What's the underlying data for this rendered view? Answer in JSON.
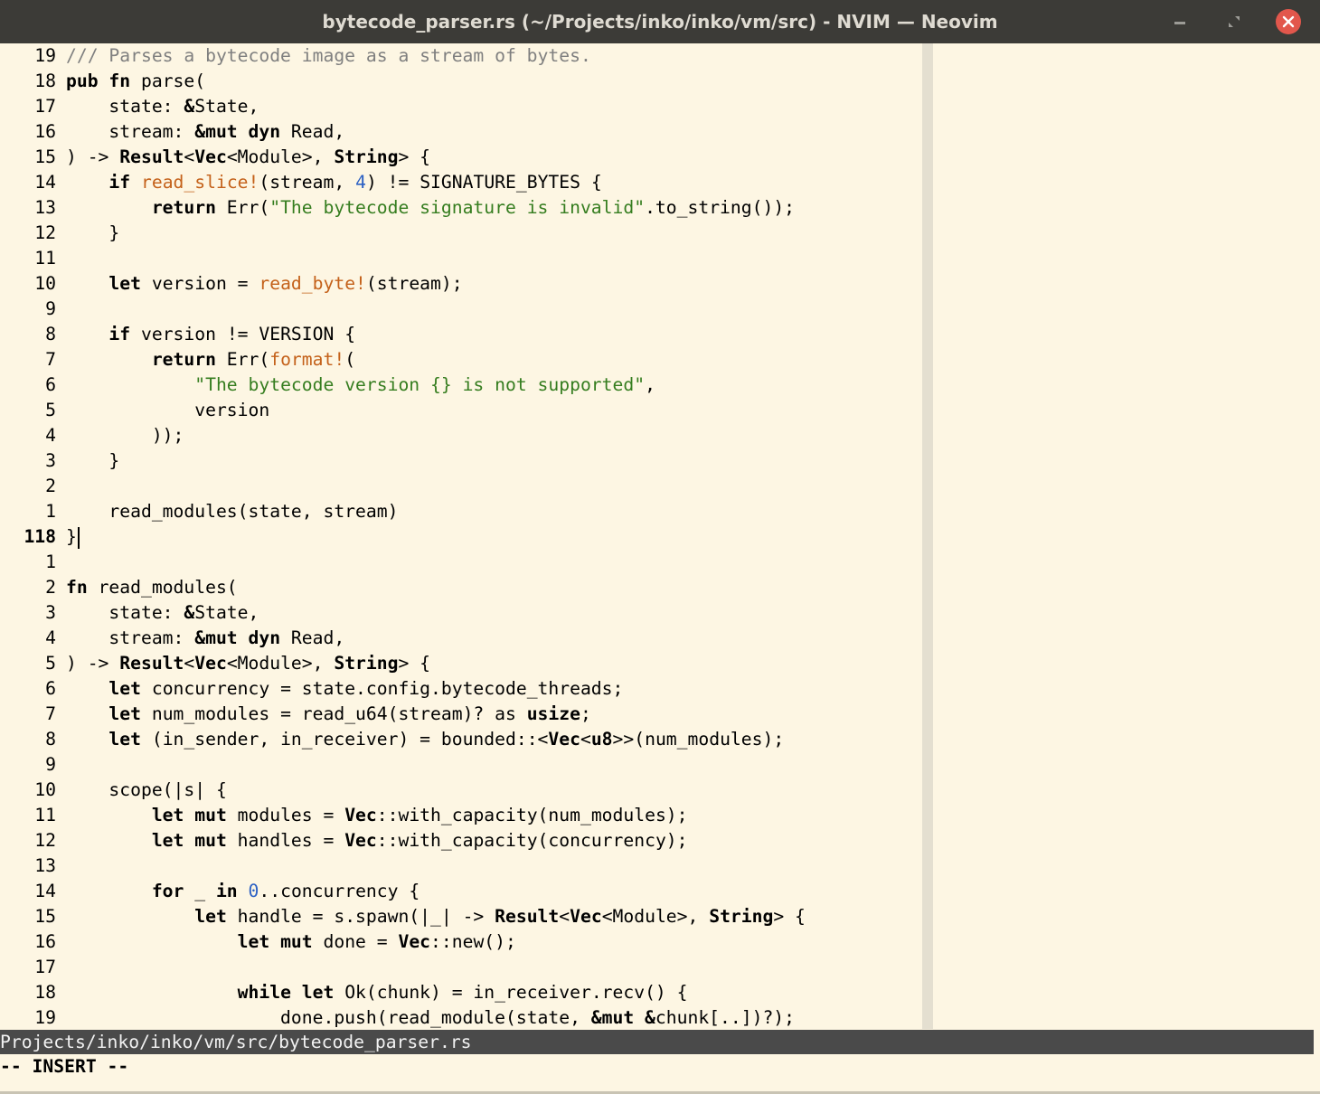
{
  "window": {
    "title": "bytecode_parser.rs (~/Projects/inko/inko/vm/src) - NVIM — Neovim",
    "buttons": {
      "minimize": "minimize",
      "maximize": "maximize",
      "close": "close"
    }
  },
  "editor": {
    "current_line": "118",
    "lines": [
      {
        "n": "19",
        "t": [
          [
            "c",
            "/// Parses a bytecode image as a stream of bytes."
          ]
        ]
      },
      {
        "n": "18",
        "t": [
          [
            "k",
            "pub fn"
          ],
          [
            "",
            "parse("
          ]
        ]
      },
      {
        "n": "17",
        "t": [
          [
            "",
            "    state: "
          ],
          [
            "k",
            "&"
          ],
          [
            "",
            "State,"
          ]
        ]
      },
      {
        "n": "16",
        "t": [
          [
            "",
            "    stream: "
          ],
          [
            "k",
            "&mut dyn"
          ],
          [
            "",
            " Read,"
          ]
        ]
      },
      {
        "n": "15",
        "t": [
          [
            "",
            ") -> "
          ],
          [
            "k",
            "Result"
          ],
          [
            "",
            "<"
          ],
          [
            "k",
            "Vec"
          ],
          [
            "",
            "<Module>, "
          ],
          [
            "k",
            "String"
          ],
          [
            "",
            "> {"
          ]
        ]
      },
      {
        "n": "14",
        "t": [
          [
            "",
            "    "
          ],
          [
            "k",
            "if"
          ],
          [
            "",
            " "
          ],
          [
            "m",
            "read_slice!"
          ],
          [
            "",
            "(stream, "
          ],
          [
            "n",
            "4"
          ],
          [
            "",
            ") != SIGNATURE_BYTES {"
          ]
        ]
      },
      {
        "n": "13",
        "t": [
          [
            "",
            "        "
          ],
          [
            "k",
            "return"
          ],
          [
            "",
            " Err("
          ],
          [
            "s",
            "\"The bytecode signature is invalid\""
          ],
          [
            "",
            ".to_string());"
          ]
        ]
      },
      {
        "n": "12",
        "t": [
          [
            "",
            "    }"
          ]
        ]
      },
      {
        "n": "11",
        "t": []
      },
      {
        "n": "10",
        "t": [
          [
            "",
            "    "
          ],
          [
            "k",
            "let"
          ],
          [
            "",
            " version = "
          ],
          [
            "m",
            "read_byte!"
          ],
          [
            "",
            "(stream);"
          ]
        ]
      },
      {
        "n": "9",
        "t": []
      },
      {
        "n": "8",
        "t": [
          [
            "",
            "    "
          ],
          [
            "k",
            "if"
          ],
          [
            "",
            " version != VERSION {"
          ]
        ]
      },
      {
        "n": "7",
        "t": [
          [
            "",
            "        "
          ],
          [
            "k",
            "return"
          ],
          [
            "",
            " Err("
          ],
          [
            "m",
            "format!"
          ],
          [
            "",
            "("
          ]
        ]
      },
      {
        "n": "6",
        "t": [
          [
            "",
            "            "
          ],
          [
            "s",
            "\"The bytecode version {} is not supported\""
          ],
          [
            "",
            ","
          ]
        ]
      },
      {
        "n": "5",
        "t": [
          [
            "",
            "            version"
          ]
        ]
      },
      {
        "n": "4",
        "t": [
          [
            "",
            "        ));"
          ]
        ]
      },
      {
        "n": "3",
        "t": [
          [
            "",
            "    }"
          ]
        ]
      },
      {
        "n": "2",
        "t": []
      },
      {
        "n": "1",
        "t": [
          [
            "",
            "    read_modules(state, stream)"
          ]
        ]
      },
      {
        "n": "118",
        "t": [
          [
            "",
            "}"
          ]
        ],
        "cursor": true
      },
      {
        "n": "1",
        "t": []
      },
      {
        "n": "2",
        "t": [
          [
            "k",
            "fn"
          ],
          [
            "",
            " read_modules("
          ]
        ]
      },
      {
        "n": "3",
        "t": [
          [
            "",
            "    state: "
          ],
          [
            "k",
            "&"
          ],
          [
            "",
            "State,"
          ]
        ]
      },
      {
        "n": "4",
        "t": [
          [
            "",
            "    stream: "
          ],
          [
            "k",
            "&mut dyn"
          ],
          [
            "",
            " Read,"
          ]
        ]
      },
      {
        "n": "5",
        "t": [
          [
            "",
            ") -> "
          ],
          [
            "k",
            "Result"
          ],
          [
            "",
            "<"
          ],
          [
            "k",
            "Vec"
          ],
          [
            "",
            "<Module>, "
          ],
          [
            "k",
            "String"
          ],
          [
            "",
            "> {"
          ]
        ]
      },
      {
        "n": "6",
        "t": [
          [
            "",
            "    "
          ],
          [
            "k",
            "let"
          ],
          [
            "",
            " concurrency = state.config.bytecode_threads;"
          ]
        ]
      },
      {
        "n": "7",
        "t": [
          [
            "",
            "    "
          ],
          [
            "k",
            "let"
          ],
          [
            "",
            " num_modules = read_u64(stream)? as "
          ],
          [
            "k",
            "usize"
          ],
          [
            "",
            ";"
          ]
        ]
      },
      {
        "n": "8",
        "t": [
          [
            "",
            "    "
          ],
          [
            "k",
            "let"
          ],
          [
            "",
            " (in_sender, in_receiver) = bounded::<"
          ],
          [
            "k",
            "Vec"
          ],
          [
            "",
            "<"
          ],
          [
            "k",
            "u8"
          ],
          [
            "",
            ">>(num_modules);"
          ]
        ]
      },
      {
        "n": "9",
        "t": []
      },
      {
        "n": "10",
        "t": [
          [
            "",
            "    scope(|s| {"
          ]
        ]
      },
      {
        "n": "11",
        "t": [
          [
            "",
            "        "
          ],
          [
            "k",
            "let mut"
          ],
          [
            "",
            " modules = "
          ],
          [
            "k",
            "Vec"
          ],
          [
            "",
            "::with_capacity(num_modules);"
          ]
        ]
      },
      {
        "n": "12",
        "t": [
          [
            "",
            "        "
          ],
          [
            "k",
            "let mut"
          ],
          [
            "",
            " handles = "
          ],
          [
            "k",
            "Vec"
          ],
          [
            "",
            "::with_capacity(concurrency);"
          ]
        ]
      },
      {
        "n": "13",
        "t": []
      },
      {
        "n": "14",
        "t": [
          [
            "",
            "        "
          ],
          [
            "k",
            "for"
          ],
          [
            "",
            " _ "
          ],
          [
            "k",
            "in"
          ],
          [
            "",
            " "
          ],
          [
            "n",
            "0"
          ],
          [
            "",
            "..concurrency {"
          ]
        ]
      },
      {
        "n": "15",
        "t": [
          [
            "",
            "            "
          ],
          [
            "k",
            "let"
          ],
          [
            "",
            " handle = s.spawn(|_| -> "
          ],
          [
            "k",
            "Result"
          ],
          [
            "",
            "<"
          ],
          [
            "k",
            "Vec"
          ],
          [
            "",
            "<Module>, "
          ],
          [
            "k",
            "String"
          ],
          [
            "",
            "> {"
          ]
        ]
      },
      {
        "n": "16",
        "t": [
          [
            "",
            "                "
          ],
          [
            "k",
            "let mut"
          ],
          [
            "",
            " done = "
          ],
          [
            "k",
            "Vec"
          ],
          [
            "",
            "::new();"
          ]
        ]
      },
      {
        "n": "17",
        "t": []
      },
      {
        "n": "18",
        "t": [
          [
            "",
            "                "
          ],
          [
            "k",
            "while let"
          ],
          [
            "",
            " Ok(chunk) = in_receiver.recv() {"
          ]
        ]
      },
      {
        "n": "19",
        "t": [
          [
            "",
            "                    done.push(read_module(state, "
          ],
          [
            "k",
            "&mut &"
          ],
          [
            "",
            "chunk[..])?);"
          ]
        ]
      }
    ]
  },
  "statusline": {
    "path": "Projects/inko/inko/vm/src/bytecode_parser.rs"
  },
  "modeline": {
    "text": "-- INSERT --"
  },
  "colors": {
    "background": "#fdf6e3",
    "titlebar": "#3c3b37",
    "comment": "#7f7f7f",
    "string": "#357d1f",
    "macro": "#c4611a",
    "number": "#2c61c4",
    "statusline": "#4a4a4a",
    "close_button": "#e2574c"
  }
}
